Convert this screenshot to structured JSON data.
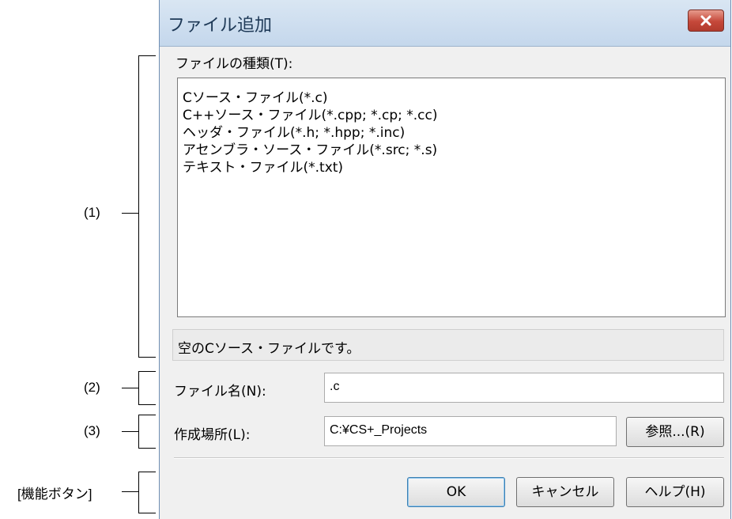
{
  "annotations": {
    "a1": "(1)",
    "a2": "(2)",
    "a3": "(3)",
    "a4": "[機能ボタン]"
  },
  "dialog": {
    "title": "ファイル追加",
    "file_type_label": "ファイルの種類(T):",
    "file_types": [
      "Cソース・ファイル(*.c)",
      "C++ソース・ファイル(*.cpp; *.cp; *.cc)",
      "ヘッダ・ファイル(*.h; *.hpp; *.inc)",
      "アセンブラ・ソース・ファイル(*.src; *.s)",
      "テキスト・ファイル(*.txt)"
    ],
    "description": "空のCソース・ファイルです。",
    "file_name_label": "ファイル名(N):",
    "file_name_value": ".c",
    "location_label": "作成場所(L):",
    "location_value": "C:¥CS+_Projects",
    "browse_label": "参照...(R)",
    "ok_label": "OK",
    "cancel_label": "キャンセル",
    "help_label": "ヘルプ(H)"
  },
  "icons": {
    "close": "close-icon"
  },
  "colors": {
    "close_button": "#c5483a",
    "title_text": "#1e3957"
  }
}
